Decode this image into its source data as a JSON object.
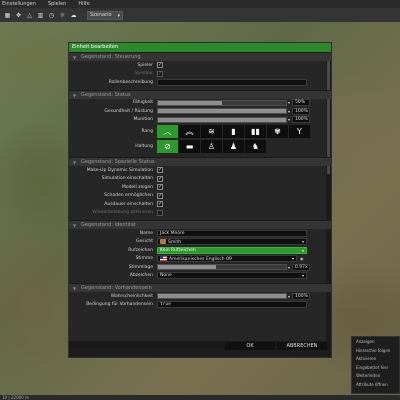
{
  "menu": {
    "items": [
      "Einstellungen",
      "Spielen",
      "Hilfe"
    ]
  },
  "toolbar": {
    "icons": [
      "grid-icon",
      "move-icon",
      "rotate-icon",
      "scale-icon",
      "clock-icon",
      "sun-icon",
      "weather-icon"
    ],
    "mode_select": "Szenario"
  },
  "dialog": {
    "title": "Einheit bearbeiten",
    "sections": {
      "steuerung": {
        "title": "Gegenstand: Steuerung",
        "spieler_label": "Spieler",
        "spieler_checked": true,
        "spielbar_label": "Spielbar",
        "spielbar_checked": true,
        "rollenbeschreibung_label": "Rollenbeschreibung",
        "rollenbeschreibung_value": ""
      },
      "status": {
        "title": "Gegenstand: Status",
        "faehigkeit_label": "Fähigkeit",
        "faehigkeit_value": "50%",
        "faehigkeit_fraction": 0.5,
        "gesundheit_label": "Gesundheit / Rüstung",
        "gesundheit_value": "100%",
        "gesundheit_fraction": 1.0,
        "munition_label": "Munition",
        "munition_value": "100%",
        "munition_fraction": 1.0,
        "rang_label": "Rang",
        "haltung_label": "Haltung",
        "rank_icons": [
          "private-icon",
          "corporal-icon",
          "sergeant-icon",
          "lieutenant-icon",
          "captain-icon",
          "major-icon",
          "colonel-icon"
        ],
        "stance_icons": [
          "none-icon",
          "prone-icon",
          "crouch-icon",
          "stand-icon",
          "auto-icon"
        ]
      },
      "spezielle": {
        "title": "Gegenstand: Spezielle Status",
        "items": [
          {
            "label": "Make-Up Dynamic Simulation",
            "checked": true,
            "dim": false
          },
          {
            "label": "Simulation einschalten",
            "checked": true,
            "dim": false
          },
          {
            "label": "Modell zeigen",
            "checked": true,
            "dim": false
          },
          {
            "label": "Schaden ermöglichen",
            "checked": true,
            "dim": false
          },
          {
            "label": "Ausdauer einschalten",
            "checked": true,
            "dim": false
          },
          {
            "label": "Wiederbelebung aktivieren",
            "checked": false,
            "dim": true
          }
        ]
      },
      "identitaet": {
        "title": "Gegenstand: Identität",
        "name_label": "Name",
        "name_value": "Jack Moore",
        "gesicht_label": "Gesicht",
        "gesicht_value": "Smith",
        "rufzeichen_label": "Rufzeichen",
        "rufzeichen_value": "Kein Rufzeichen",
        "stimme_label": "Stimme",
        "stimme_value": "Amerikanisches Englisch 09",
        "stimmlage_label": "Stimmlage",
        "stimmlage_value": "0.97x",
        "stimmlage_fraction": 0.45,
        "abzeichen_label": "Abzeichen",
        "abzeichen_value": "None"
      },
      "vorhandensein": {
        "title": "Gegenstand: Vorhandensein",
        "wahrscheinlichkeit_label": "Wahrscheinlichkeit",
        "wahrscheinlichkeit_value": "100%",
        "wahrscheinlichkeit_fraction": 1.0,
        "bedingung_label": "Bedingung für Vorhandensein",
        "bedingung_value": "true"
      }
    },
    "ok_label": "OK",
    "cancel_label": "ABBRECHEN"
  },
  "context_menu": {
    "items": [
      "Anzeigen",
      "Hierarchie folgen",
      "Aktivieren",
      "Eingebettet hier",
      "Weiterleiten",
      "Attribute öffnen"
    ]
  },
  "statusbar": {
    "text": "10 | 22000 m"
  }
}
